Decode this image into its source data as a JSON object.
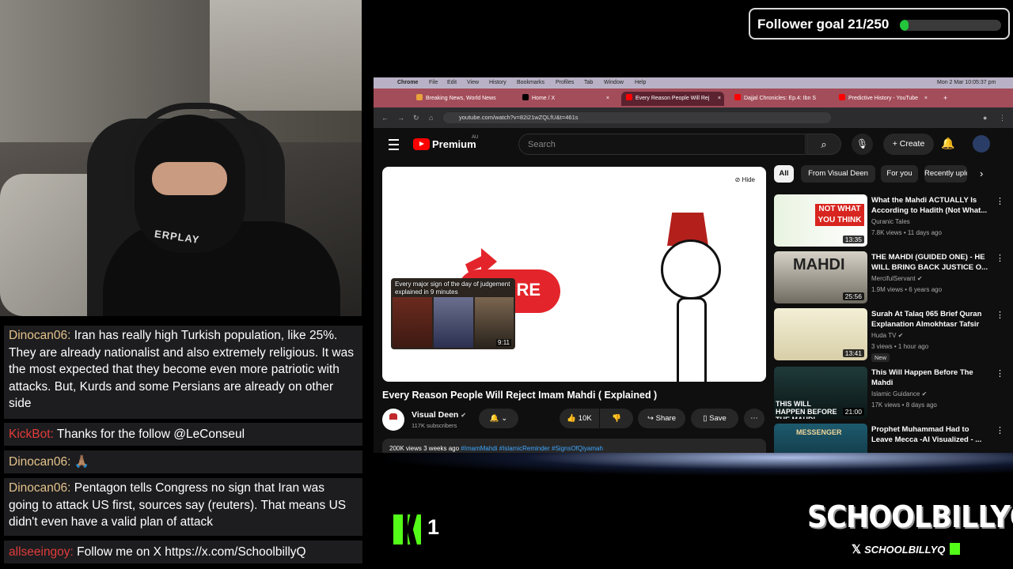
{
  "stream": {
    "shirt_text": "ERPLAY",
    "follower_goal": {
      "label": "Follower goal 21/250",
      "current": 21,
      "target": 250,
      "color": "#22c53b"
    },
    "kick_viewers": "1",
    "brand_name": "SCHOOLBILLYQ",
    "social_handle": "SCHOOLBILLYQ",
    "accent_kick": "#53fc18"
  },
  "chat": [
    {
      "user": "Dinocan06:",
      "text": "Iran has really high Turkish population, like 25%. They are already nationalist and also extremely religious. It was the most expected that they become even more patriotic with attacks. But, Kurds and some Persians are already on other side",
      "user_color": "#e4c28b"
    },
    {
      "user": "KickBot:",
      "text": "Thanks for the follow @LeConseul",
      "user_color": "#e23b3b"
    },
    {
      "user": "Dinocan06:",
      "text": "🙏🏽",
      "user_color": "#e4c28b"
    },
    {
      "user": "Dinocan06:",
      "text": "Pentagon tells Congress no sign that Iran was going to attack US first, sources say (reuters). That means US didn't even have a valid plan of attack",
      "user_color": "#e4c28b"
    },
    {
      "user": "allseeingoy:",
      "text": "Follow me on X https://x.com/SchoolbillyQ",
      "user_color": "#e23b3b"
    }
  ],
  "mac_menu": {
    "app": "Chrome",
    "items": [
      "File",
      "Edit",
      "View",
      "History",
      "Bookmarks",
      "Profiles",
      "Tab",
      "Window",
      "Help"
    ],
    "clock": "Mon 2 Mar  10:05:37 pm"
  },
  "tabs": [
    {
      "label": "Breaking News, World News",
      "icon": "news-favicon",
      "color": "#e8a23a"
    },
    {
      "label": "Home / X",
      "icon": "x-favicon",
      "color": "#000000"
    },
    {
      "label": "Every Reason People Will Rej",
      "icon": "youtube-favicon",
      "color": "#ff0000",
      "active": true
    },
    {
      "label": "Dajjal Chronicles: Ep.4: Ibn S",
      "icon": "youtube-favicon",
      "color": "#ff0000"
    },
    {
      "label": "Predictive History - YouTube",
      "icon": "youtube-favicon",
      "color": "#ff0000"
    }
  ],
  "address": {
    "url": "youtube.com/watch?v=82i21wZQLfU&t=461s"
  },
  "youtube": {
    "brand": "Premium",
    "region": "AU",
    "search_placeholder": "Search",
    "create_label": "Create",
    "player": {
      "hide_label": "Hide",
      "button_text": "RE",
      "preview_title": "Every major sign of the day of judgement explained in 9 minutes",
      "preview_duration": "9:11"
    },
    "video_title": "Every Reason People Will Reject Imam Mahdi ( Explained )",
    "channel": {
      "name": "Visual Deen",
      "verified_mark": "✔",
      "subs": "117K subscribers"
    },
    "actions": {
      "likes": "10K",
      "share": "Share",
      "save": "Save"
    },
    "description": {
      "views": "200K views  3 weeks ago",
      "tags": "#ImamMahdi #IslamicReminder #SignsOfQiyamah"
    },
    "chips": [
      "All",
      "From Visual Deen",
      "For you",
      "Recently uploaded"
    ],
    "recommendations": [
      {
        "title": "What the Mahdi ACTUALLY Is According to Hadith (Not What...",
        "channel": "Quranic Tales",
        "verified": false,
        "meta": "7.8K views • 11 days ago",
        "duration": "13:35",
        "thumb_text": "NOT WHAT YOU THINK"
      },
      {
        "title": "THE MAHDI (GUIDED ONE) - HE WILL BRING BACK JUSTICE O...",
        "channel": "MercifulServant",
        "verified": true,
        "meta": "1.9M views • 6 years ago",
        "duration": "25:56",
        "thumb_text": "MAHDI"
      },
      {
        "title": "Surah At Talaq 065 Brief Quran Explanation  Almokhtasr Tafsir",
        "channel": "Huda TV",
        "verified": true,
        "meta": "3 views • 1 hour ago",
        "duration": "13:41",
        "badge": "New",
        "thumb_text": ""
      },
      {
        "title": "This Will Happen Before The Mahdi",
        "channel": "Islamic Guidance",
        "verified": true,
        "meta": "17K views • 8 days ago",
        "duration": "21:00",
        "thumb_text": "THIS WILL HAPPEN BEFORE THE MAHDI"
      },
      {
        "title": "Prophet Muhammad Had to Leave Mecca -AI Visualized - ...",
        "channel": "",
        "verified": false,
        "meta": "",
        "duration": "",
        "thumb_text": "MESSENGER"
      }
    ]
  }
}
